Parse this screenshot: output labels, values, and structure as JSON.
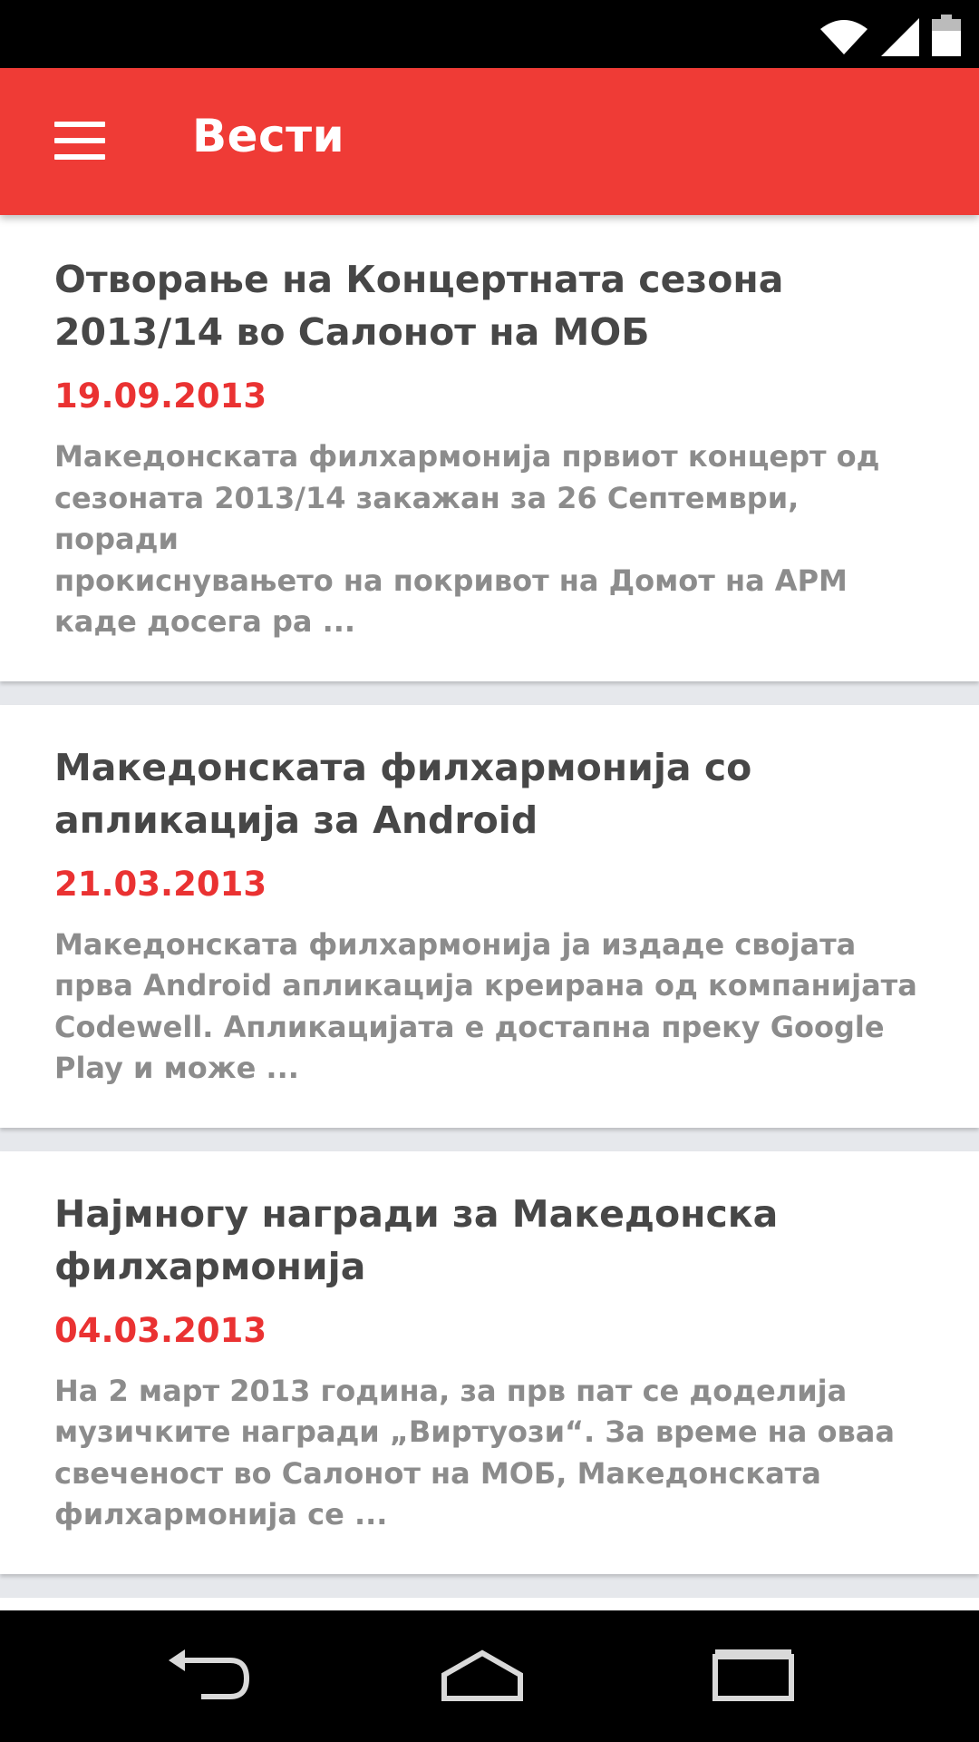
{
  "app_bar": {
    "title": "Вести",
    "color": "#ef3b36"
  },
  "icons": {
    "wifi": "wifi-icon",
    "signal": "cell-signal-icon",
    "battery": "battery-icon",
    "menu": "menu-icon",
    "back": "back-icon",
    "home": "home-icon",
    "recents": "recents-icon"
  },
  "news": [
    {
      "title": "Отворање на Концертната сезона 2013/14 во Салонот на МОБ",
      "date": "19.09.2013",
      "excerpt": "Македонската филхармонија првиот концерт од\nсезоната 2013/14 закажан за 26 Септември, поради\nпрокиснувањето на покривот на Домот на АРМ\nкаде досега ра ..."
    },
    {
      "title": "Македонската филхармонија со апликација за Android",
      "date": "21.03.2013",
      "excerpt": "Македонската филхармонија ја издаде својата\nпрва Android апликација креирана од компанијата\nCodewell. Апликацијата е достапна преку Google\nPlay и може ..."
    },
    {
      "title": "Најмногу награди за Македонска филхармонија",
      "date": "04.03.2013",
      "excerpt": "На 2 март 2013 година, за прв пат се доделија\nмузичките награди „Виртуози“. За време на оваа\nсвеченост во Салонот на МОБ, Македонската\nфилхармонија се ..."
    }
  ],
  "accent_colors": {
    "date": "#ea3232",
    "title": "#474747",
    "excerpt": "#8c8c8c"
  }
}
